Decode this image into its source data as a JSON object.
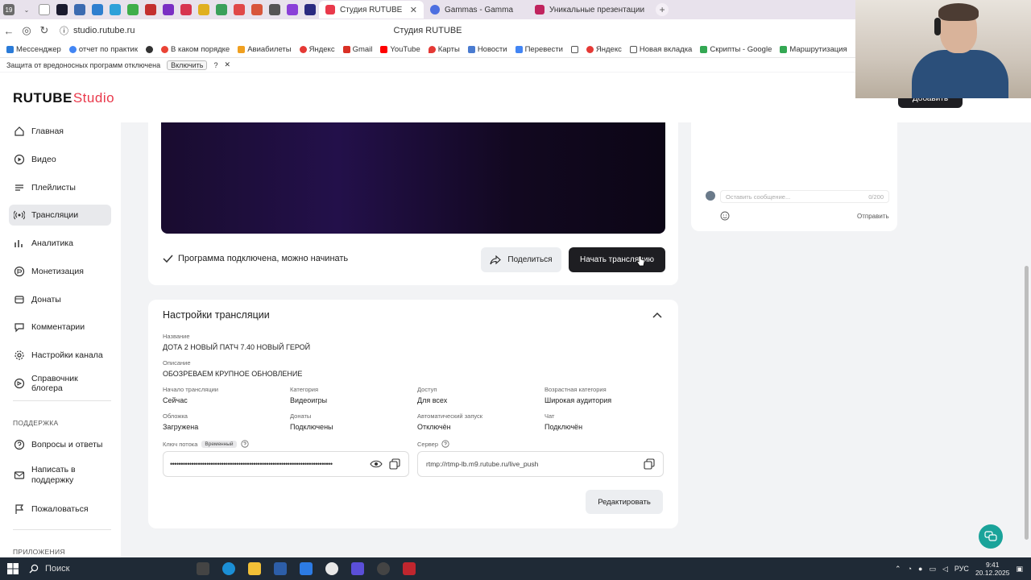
{
  "browser": {
    "tab_count_badge": "19",
    "tabs": [
      {
        "title": "Студия RUTUBE",
        "active": true
      },
      {
        "title": "Gammas - Gamma",
        "active": false
      },
      {
        "title": "Уникальные презентации",
        "active": false
      }
    ],
    "close_glyph": "✕",
    "new_tab_glyph": "+",
    "url": "studio.rutube.ru",
    "page_title": "Студия RUTUBE",
    "bookmarks": [
      "Мессенджер",
      "отчет по практик",
      "В каком порядке",
      "Авиабилеты",
      "Яндекс",
      "Gmail",
      "YouTube",
      "Карты",
      "Новости",
      "Перевести",
      "Яндекс",
      "Новая вкладка",
      "Скрипты - Google",
      "Маршрутизация"
    ],
    "notice": {
      "text": "Защита от вредоносных программ отключена",
      "button": "Включить",
      "help": "?",
      "close": "✕"
    }
  },
  "app": {
    "logo_main": "RUTUBE",
    "logo_sub": "Studio",
    "add_button": "Добавить"
  },
  "sidebar": {
    "items": [
      {
        "label": "Главная",
        "icon": "home-icon"
      },
      {
        "label": "Видео",
        "icon": "play-icon"
      },
      {
        "label": "Плейлисты",
        "icon": "playlist-icon"
      },
      {
        "label": "Трансляции",
        "icon": "broadcast-icon",
        "active": true
      },
      {
        "label": "Аналитика",
        "icon": "chart-icon"
      },
      {
        "label": "Монетизация",
        "icon": "coin-icon"
      },
      {
        "label": "Донаты",
        "icon": "donate-icon"
      },
      {
        "label": "Комментарии",
        "icon": "comment-icon"
      },
      {
        "label": "Настройки канала",
        "icon": "gear-icon"
      },
      {
        "label": "Справочник блогера",
        "icon": "book-icon"
      }
    ],
    "support_label": "ПОДДЕРЖКА",
    "support_items": [
      {
        "label": "Вопросы и ответы",
        "icon": "question-icon"
      },
      {
        "label": "Написать в поддержку",
        "icon": "mail-icon"
      },
      {
        "label": "Пожаловаться",
        "icon": "flag-icon"
      }
    ],
    "apps_label": "ПРИЛОЖЕНИЯ"
  },
  "stream": {
    "status": "Программа подключена, можно начинать",
    "share_button": "Поделиться",
    "start_button": "Начать трансляцию"
  },
  "chat": {
    "placeholder": "Оставить сообщение...",
    "counter": "0/200",
    "send": "Отправить"
  },
  "settings": {
    "title": "Настройки трансляции",
    "name_label": "Название",
    "name_value": "ДОТА 2 НОВЫЙ ПАТЧ 7.40 НОВЫЙ ГЕРОЙ",
    "desc_label": "Описание",
    "desc_value": "ОБОЗРЕВАЕМ КРУПНОЕ ОБНОВЛЕНИЕ",
    "grid": [
      {
        "label": "Начало трансляции",
        "value": "Сейчас"
      },
      {
        "label": "Категория",
        "value": "Видеоигры"
      },
      {
        "label": "Доступ",
        "value": "Для всех"
      },
      {
        "label": "Возрастная категория",
        "value": "Широкая аудитория"
      },
      {
        "label": "Обложка",
        "value": "Загружена"
      },
      {
        "label": "Донаты",
        "value": "Подключены"
      },
      {
        "label": "Автоматический запуск",
        "value": "Отключён"
      },
      {
        "label": "Чат",
        "value": "Подключён"
      }
    ],
    "key_label": "Ключ потока",
    "key_badge": "Временный",
    "key_value": "••••••••••••••••••••••••••••••••••••••••••••••••••••••••••••••••••••••••••••",
    "server_label": "Сервер",
    "server_value": "rtmp://rtmp-lb.m9.rutube.ru/live_push",
    "edit_button": "Редактировать"
  },
  "taskbar": {
    "search": "Поиск",
    "lang": "РУС",
    "time": "9:41",
    "date": "20.12.2025"
  }
}
